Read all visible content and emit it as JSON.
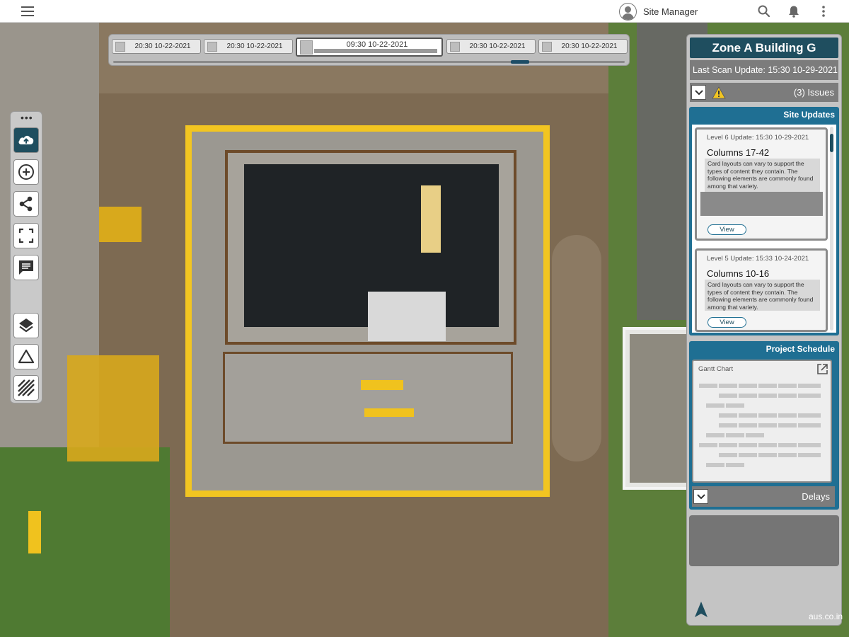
{
  "header": {
    "user_name": "Site Manager"
  },
  "timeline": {
    "items": [
      {
        "label": "20:30 10-22-2021"
      },
      {
        "label": "20:30 10-22-2021"
      },
      {
        "label": "09:30 10-22-2021"
      },
      {
        "label": "20:30 10-22-2021"
      },
      {
        "label": "20:30 10-22-2021"
      }
    ],
    "active_index": 2
  },
  "toolbar": {
    "menu_dots": "•••",
    "tools": [
      {
        "icon": "cloud-upload-icon",
        "active": true
      },
      {
        "icon": "add-circle-icon",
        "active": false
      },
      {
        "icon": "share-icon",
        "active": false
      },
      {
        "icon": "fullscreen-icon",
        "active": false
      },
      {
        "icon": "comment-icon",
        "active": false
      },
      {
        "icon": "layers-icon",
        "active": false
      },
      {
        "icon": "triangle-icon",
        "active": false
      },
      {
        "icon": "hatch-pattern-icon",
        "active": false
      }
    ]
  },
  "panel": {
    "zone_title": "Zone A Building G",
    "last_scan": "Last Scan Update: 15:30 10-29-2021",
    "issues_label": "(3) Issues",
    "site_updates": {
      "heading": "Site Updates",
      "cards": [
        {
          "meta": "Level 6 Update: 15:30 10-29-2021",
          "title": "Columns 17-42",
          "description": "Card layouts can vary to support the types of content they contain. The following elements are commonly found among that variety.",
          "button": "View"
        },
        {
          "meta": "Level 5 Update: 15:33 10-24-2021",
          "title": "Columns 10-16",
          "description": "Card layouts can vary to support the types of content they contain. The following elements are commonly found among that variety.",
          "button": "View"
        }
      ]
    },
    "project_schedule": {
      "heading": "Project Schedule",
      "gantt_title": "Gantt Chart",
      "delays_label": "Delays"
    },
    "watermark": "aus.co.in"
  },
  "colors": {
    "accent_dark": "#1f4e5f",
    "accent_blue": "#1f6f93",
    "warning": "#f2c521"
  }
}
